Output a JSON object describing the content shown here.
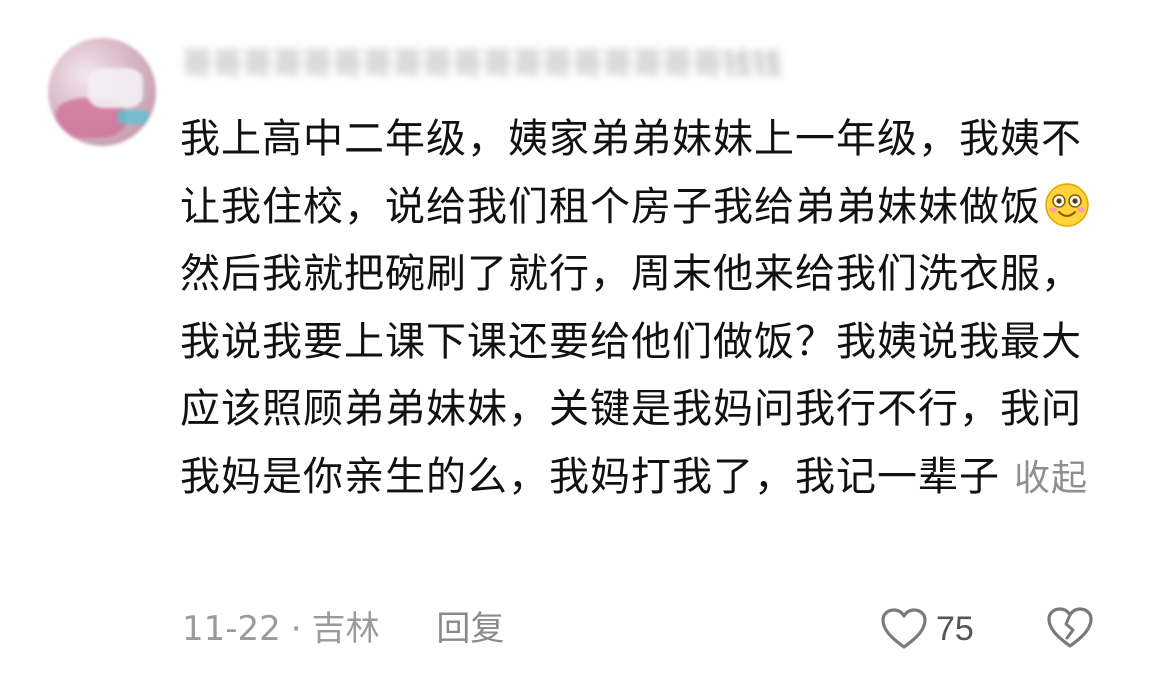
{
  "comment": {
    "username": "哥哥哥哥哥哥哥哥哥哥哥哥哥哥哥哥哥哥钱钱",
    "text_before_emoji": "我上高中二年级，姨家弟弟妹妹上一年级，我姨不让我住校，说给我们租个房子我给弟弟妹妹做饭",
    "emoji": "smile-emoji",
    "text_after_emoji": "然后我就把碗刷了就行，周末他来给我们洗衣服，我说我要上课下课还要给他们做饭？我姨说我最大应该照顾弟弟妹妹，关键是我妈问我行不行，我问我妈是你亲生的么，我妈打我了，我记一辈子",
    "collapse_label": "收起"
  },
  "meta": {
    "date": "11-22",
    "separator": "·",
    "location": "吉林",
    "reply_label": "回复"
  },
  "actions": {
    "like_count": "75",
    "like_icon": "heart-outline-icon",
    "dislike_icon": "broken-heart-icon"
  }
}
